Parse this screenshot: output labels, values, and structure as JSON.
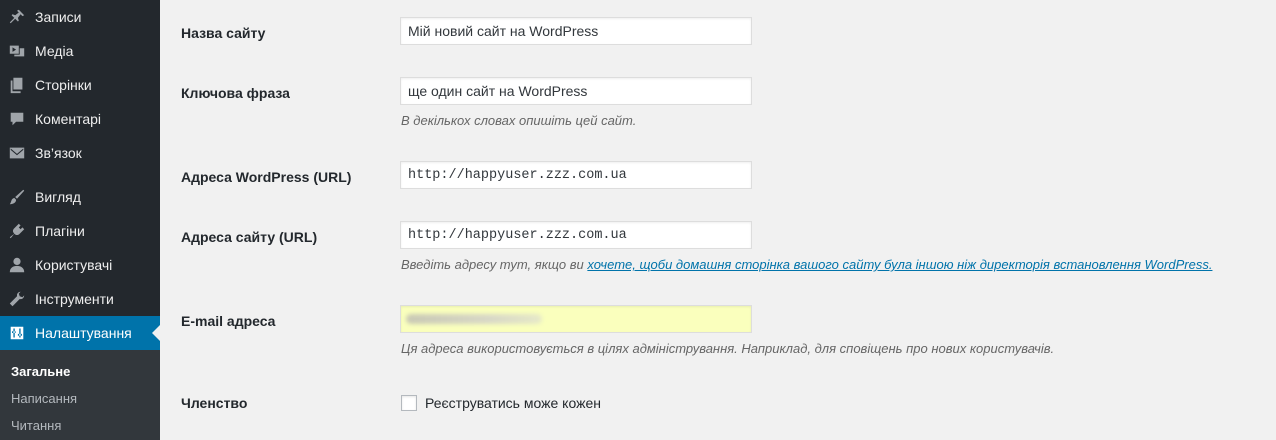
{
  "sidebar": {
    "items": [
      {
        "label": "Записи",
        "icon": "pushpin-icon"
      },
      {
        "label": "Медіа",
        "icon": "media-icon"
      },
      {
        "label": "Сторінки",
        "icon": "pages-icon"
      },
      {
        "label": "Коментарі",
        "icon": "comment-icon"
      },
      {
        "label": "Зв’язок",
        "icon": "mail-icon"
      },
      {
        "label": "Вигляд",
        "icon": "brush-icon"
      },
      {
        "label": "Плагіни",
        "icon": "plugin-icon"
      },
      {
        "label": "Користувачі",
        "icon": "user-icon"
      },
      {
        "label": "Інструменти",
        "icon": "wrench-icon"
      },
      {
        "label": "Налаштування",
        "icon": "settings-icon"
      }
    ],
    "current": "Налаштування",
    "submenu": [
      "Загальне",
      "Написання",
      "Читання"
    ]
  },
  "form": {
    "site_title": {
      "label": "Назва сайту",
      "value": "Мій новий сайт на WordPress"
    },
    "tagline": {
      "label": "Ключова фраза",
      "value": "ще один сайт на WordPress",
      "description": "В декількох словах опишіть цей сайт."
    },
    "wp_address": {
      "label": "Адреса WordPress (URL)",
      "value": "http://happyuser.zzz.com.ua"
    },
    "site_address": {
      "label": "Адреса сайту (URL)",
      "value": "http://happyuser.zzz.com.ua",
      "description_prefix": "Введіть адресу тут, якщо ви ",
      "description_link": "хочете, щоби домашня сторінка вашого сайту була іншою ніж директорія встановлення WordPress."
    },
    "email": {
      "label": "E-mail адреса",
      "description": "Ця адреса використовується в цілях адміністрування. Наприклад, для сповіщень про нових користувачів."
    },
    "membership": {
      "label": "Членство",
      "checkbox_label": "Реєструватись може кожен",
      "checked": false
    }
  },
  "colors": {
    "sidebar_bg": "#23282d",
    "accent": "#0073aa",
    "autofill": "#faffbd"
  }
}
